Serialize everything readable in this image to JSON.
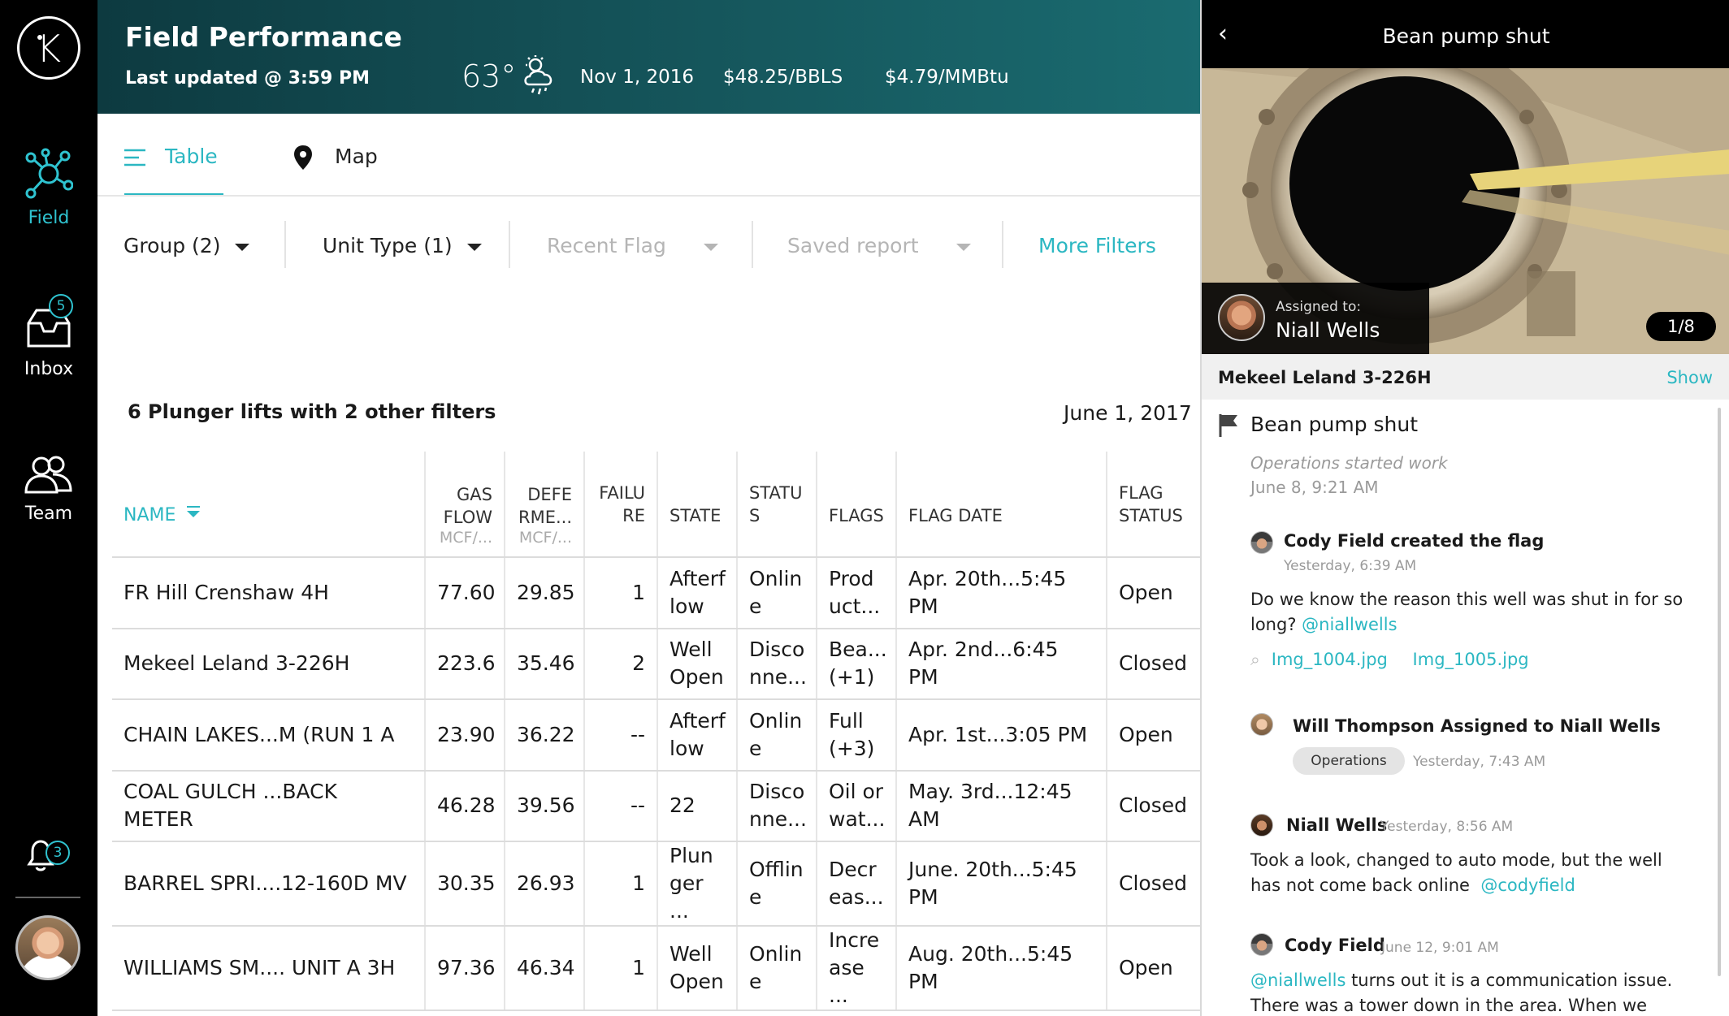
{
  "nav": {
    "logo_letter": "K",
    "items": [
      {
        "label": "Field",
        "icon": "network-icon"
      },
      {
        "label": "Inbox",
        "icon": "inbox-icon",
        "badge": "5"
      },
      {
        "label": "Team",
        "icon": "team-icon"
      }
    ],
    "notifications_badge": "3"
  },
  "header": {
    "title": "Field Performance",
    "updated": "Last updated @ 3:59 PM",
    "temperature": "63°",
    "date": "Nov 1, 2016",
    "oil_price": "$48.25/BBLS",
    "gas_price": "$4.79/MMBtu"
  },
  "tabs": {
    "table": "Table",
    "map": "Map"
  },
  "filters": {
    "group": "Group (2)",
    "unit_type": "Unit Type (1)",
    "recent_flag": "Recent Flag",
    "saved_report": "Saved report",
    "more": "More Filters"
  },
  "summary": {
    "text": "6 Plunger lifts with 2 other filters",
    "date": "June 1, 2017"
  },
  "table": {
    "headers": {
      "name": "NAME",
      "gas_flow": "GAS FLOW",
      "gas_flow_unit": "MCF/...",
      "deferment": "DEFE RME...",
      "deferment_unit": "MCF/...",
      "failure": "FAILU RE",
      "state": "STATE",
      "status": "STATU S",
      "flags": "FLAGS",
      "flag_date": "FLAG DATE",
      "flag_status": "FLAG STATUS"
    },
    "rows": [
      {
        "name": "FR Hill Crenshaw 4H",
        "gas_flow": "77.60",
        "deferment": "29.85",
        "failure": "1",
        "state": "Afterf low",
        "status": "Onlin e",
        "flags": "Prod uct...",
        "flag_date": "Apr. 20th...5:45 PM",
        "flag_status": "Open"
      },
      {
        "name": "Mekeel Leland 3-226H",
        "gas_flow": "223.6",
        "deferment": "35.46",
        "failure": "2",
        "state": "Well Open",
        "status": "Disco nne...",
        "flags": "Bea... (+1)",
        "flag_date": "Apr. 2nd...6:45 PM",
        "flag_status": "Closed"
      },
      {
        "name": "CHAIN LAKES...M (RUN 1 A",
        "gas_flow": "23.90",
        "deferment": "36.22",
        "failure": "--",
        "state": "Afterf low",
        "status": "Onlin e",
        "flags": "Full (+3)",
        "flag_date": "Apr. 1st...3:05 PM",
        "flag_status": "Open"
      },
      {
        "name": "COAL GULCH ...BACK METER",
        "gas_flow": "46.28",
        "deferment": "39.56",
        "failure": "--",
        "state": "22",
        "status": "Disco nne...",
        "flags": "Oil or wat...",
        "flag_date": "May. 3rd...12:45 AM",
        "flag_status": "Closed"
      },
      {
        "name": "BARREL SPRI....12-160D MV",
        "gas_flow": "30.35",
        "deferment": "26.93",
        "failure": "1",
        "state": "Plun ger ...",
        "status": "Offlin e",
        "flags": "Decr eas...",
        "flag_date": "June. 20th...5:45 PM",
        "flag_status": "Closed"
      },
      {
        "name": "WILLIAMS SM.... UNIT A 3H",
        "gas_flow": "97.36",
        "deferment": "46.34",
        "failure": "1",
        "state": "Well Open",
        "status": "Onlin e",
        "flags": "Incre ase ...",
        "flag_date": "Aug. 20th...5:45 PM",
        "flag_status": "Open"
      }
    ]
  },
  "panel": {
    "title": "Bean pump shut",
    "assigned_label": "Assigned to:",
    "assigned_name": "Niall Wells",
    "photo_counter": "1/8",
    "well_name": "Mekeel Leland 3-226H",
    "show": "Show",
    "flag_title": "Bean pump shut",
    "ops_note": "Operations started work",
    "ops_date": "June 8, 9:21 AM",
    "c1_name": "Cody Field created the flag",
    "c1_time": "Yesterday, 6:39 AM",
    "c1_text": "Do we know the reason this well was shut in for so long?",
    "c1_mention": "@niallwells",
    "c1_file1": "Img_1004.jpg",
    "c1_file2": "Img_1005.jpg",
    "c2_name": "Will Thompson Assigned to Niall Wells",
    "c2_tag": "Operations",
    "c2_time": "Yesterday, 7:43 AM",
    "c3_name": "Niall Wells",
    "c3_time": "Yesterday, 8:56 AM",
    "c3_text": "Took a look, changed to auto mode, but the well has not come back online",
    "c3_mention": "@codyfield",
    "c4_name": "Cody Field",
    "c4_time": "June 12, 9:01 AM",
    "c4_mention": "@niallwells",
    "c4_text": "turns out it is a communication issue. There was a tower down in the area. When we gain"
  }
}
